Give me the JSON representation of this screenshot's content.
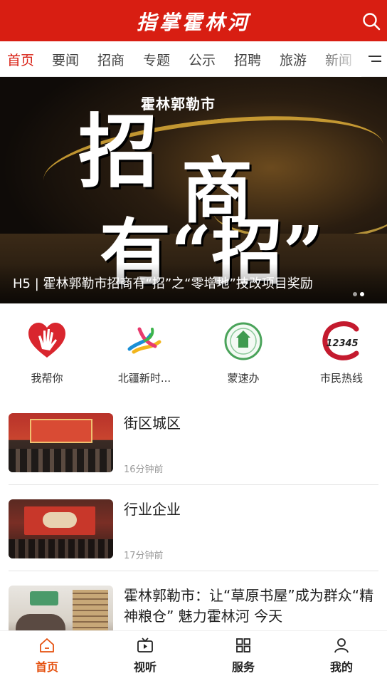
{
  "header": {
    "title": "指掌霍林河"
  },
  "tabs": [
    "首页",
    "要闻",
    "招商",
    "专题",
    "公示",
    "招聘",
    "旅游",
    "新闻"
  ],
  "banner": {
    "subtitle": "霍林郭勒市",
    "big_line1": "招",
    "big_line2": "商",
    "big_line3": "有“招”",
    "caption": "H5  |  霍林郭勒市招商有“招”之“零增地”技改项目奖励"
  },
  "quick": [
    {
      "label": "我帮你",
      "icon": "hands-heart-icon"
    },
    {
      "label": "北疆新时...",
      "icon": "beijiang-logo-icon"
    },
    {
      "label": "蒙速办",
      "icon": "mengsuban-logo-icon"
    },
    {
      "label": "市民热线",
      "icon": "hotline-12345-icon"
    }
  ],
  "hotline_number": "12345",
  "news": [
    {
      "title": "街区城区",
      "time": "16分钟前"
    },
    {
      "title": "行业企业",
      "time": "17分钟前"
    },
    {
      "title": "霍林郭勒市：让“草原书屋”成为群众“精神粮仓”  魅力霍林河  今天",
      "time": ""
    }
  ],
  "bottom_nav": [
    {
      "label": "首页",
      "icon": "home-icon"
    },
    {
      "label": "视听",
      "icon": "video-icon"
    },
    {
      "label": "服务",
      "icon": "grid-icon"
    },
    {
      "label": "我的",
      "icon": "user-icon"
    }
  ],
  "colors": {
    "brand_red": "#d81e12",
    "active_orange": "#e5500e"
  }
}
